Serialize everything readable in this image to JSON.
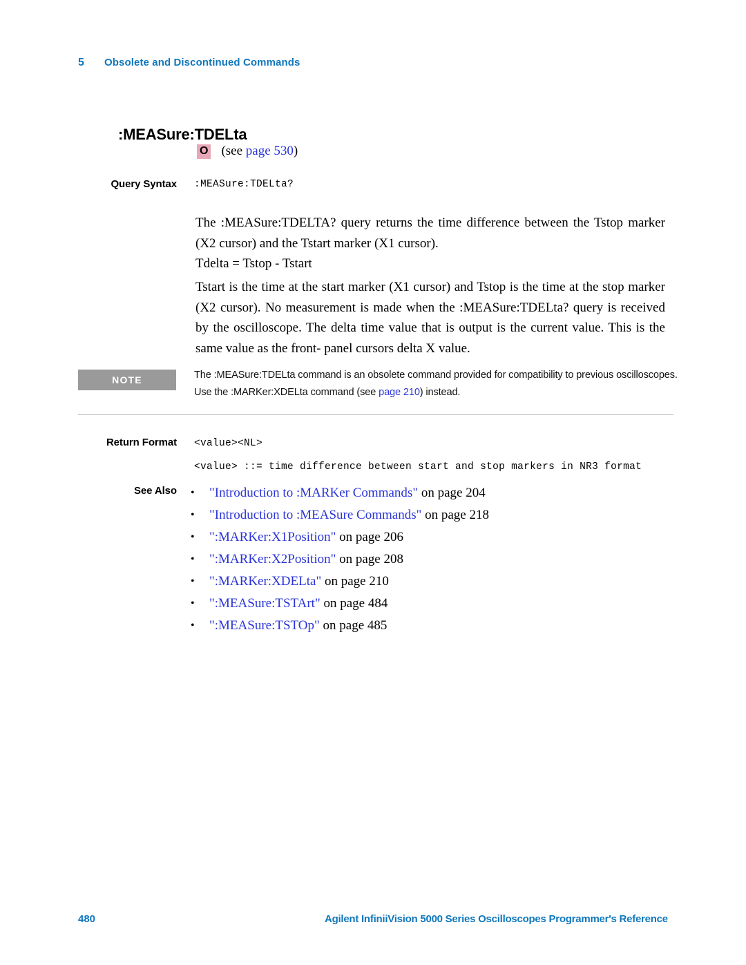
{
  "running_header": {
    "chapter_number": "5",
    "chapter_title": "Obsolete and Discontinued Commands"
  },
  "page_title": ":MEASure:TDELta",
  "obsolete_marker": {
    "badge": "O",
    "see_prefix": "(see ",
    "link_text": "page 530",
    "see_suffix": ")"
  },
  "sections": {
    "query_syntax": {
      "label": "Query Syntax",
      "code": ":MEASure:TDELta?"
    },
    "return_format": {
      "label": "Return Format",
      "code_line1": "<value><NL>",
      "code_line2": "<value> ::= time difference between start and stop markers in NR3 format"
    },
    "see_also": {
      "label": "See Also"
    }
  },
  "paragraphs": {
    "p1": "The :MEASure:TDELTA? query returns the time difference between the Tstop marker (X2 cursor) and the Tstart marker (X1 cursor).",
    "p2": "Tdelta = Tstop - Tstart",
    "p3": "Tstart is the time at the start marker (X1 cursor) and Tstop is the time at the stop marker (X2 cursor). No measurement is made when the :MEASure:TDELta? query is received by the oscilloscope. The delta time value that is output is the current value. This is the same value as the front- panel cursors delta X value."
  },
  "note": {
    "label": "NOTE",
    "text_before_link": "The :MEASure:TDELta command is an obsolete command provided for compatibility to previous oscilloscopes. Use the :MARKer:XDELta command (see ",
    "link_text": "page 210",
    "text_after_link": ") instead."
  },
  "see_also_items": [
    {
      "title": "\"Introduction to :MARKer Commands\"",
      "page": " on page 204"
    },
    {
      "title": "\"Introduction to :MEASure Commands\"",
      "page": " on page 218"
    },
    {
      "title": "\":MARKer:X1Position\"",
      "page": " on page 206"
    },
    {
      "title": "\":MARKer:X2Position\"",
      "page": " on page 208"
    },
    {
      "title": "\":MARKer:XDELta\"",
      "page": " on page 210"
    },
    {
      "title": "\":MEASure:TSTArt\"",
      "page": " on page 484"
    },
    {
      "title": "\":MEASure:TSTOp\"",
      "page": " on page 485"
    }
  ],
  "footer": {
    "page_number": "480",
    "title": "Agilent InfiniiVision 5000 Series Oscilloscopes Programmer's Reference"
  },
  "colors": {
    "brand_blue": "#1077BC",
    "link_blue": "#2A34D8",
    "note_gray": "#9A9A9A",
    "badge_pink": "#E8A7B8"
  }
}
